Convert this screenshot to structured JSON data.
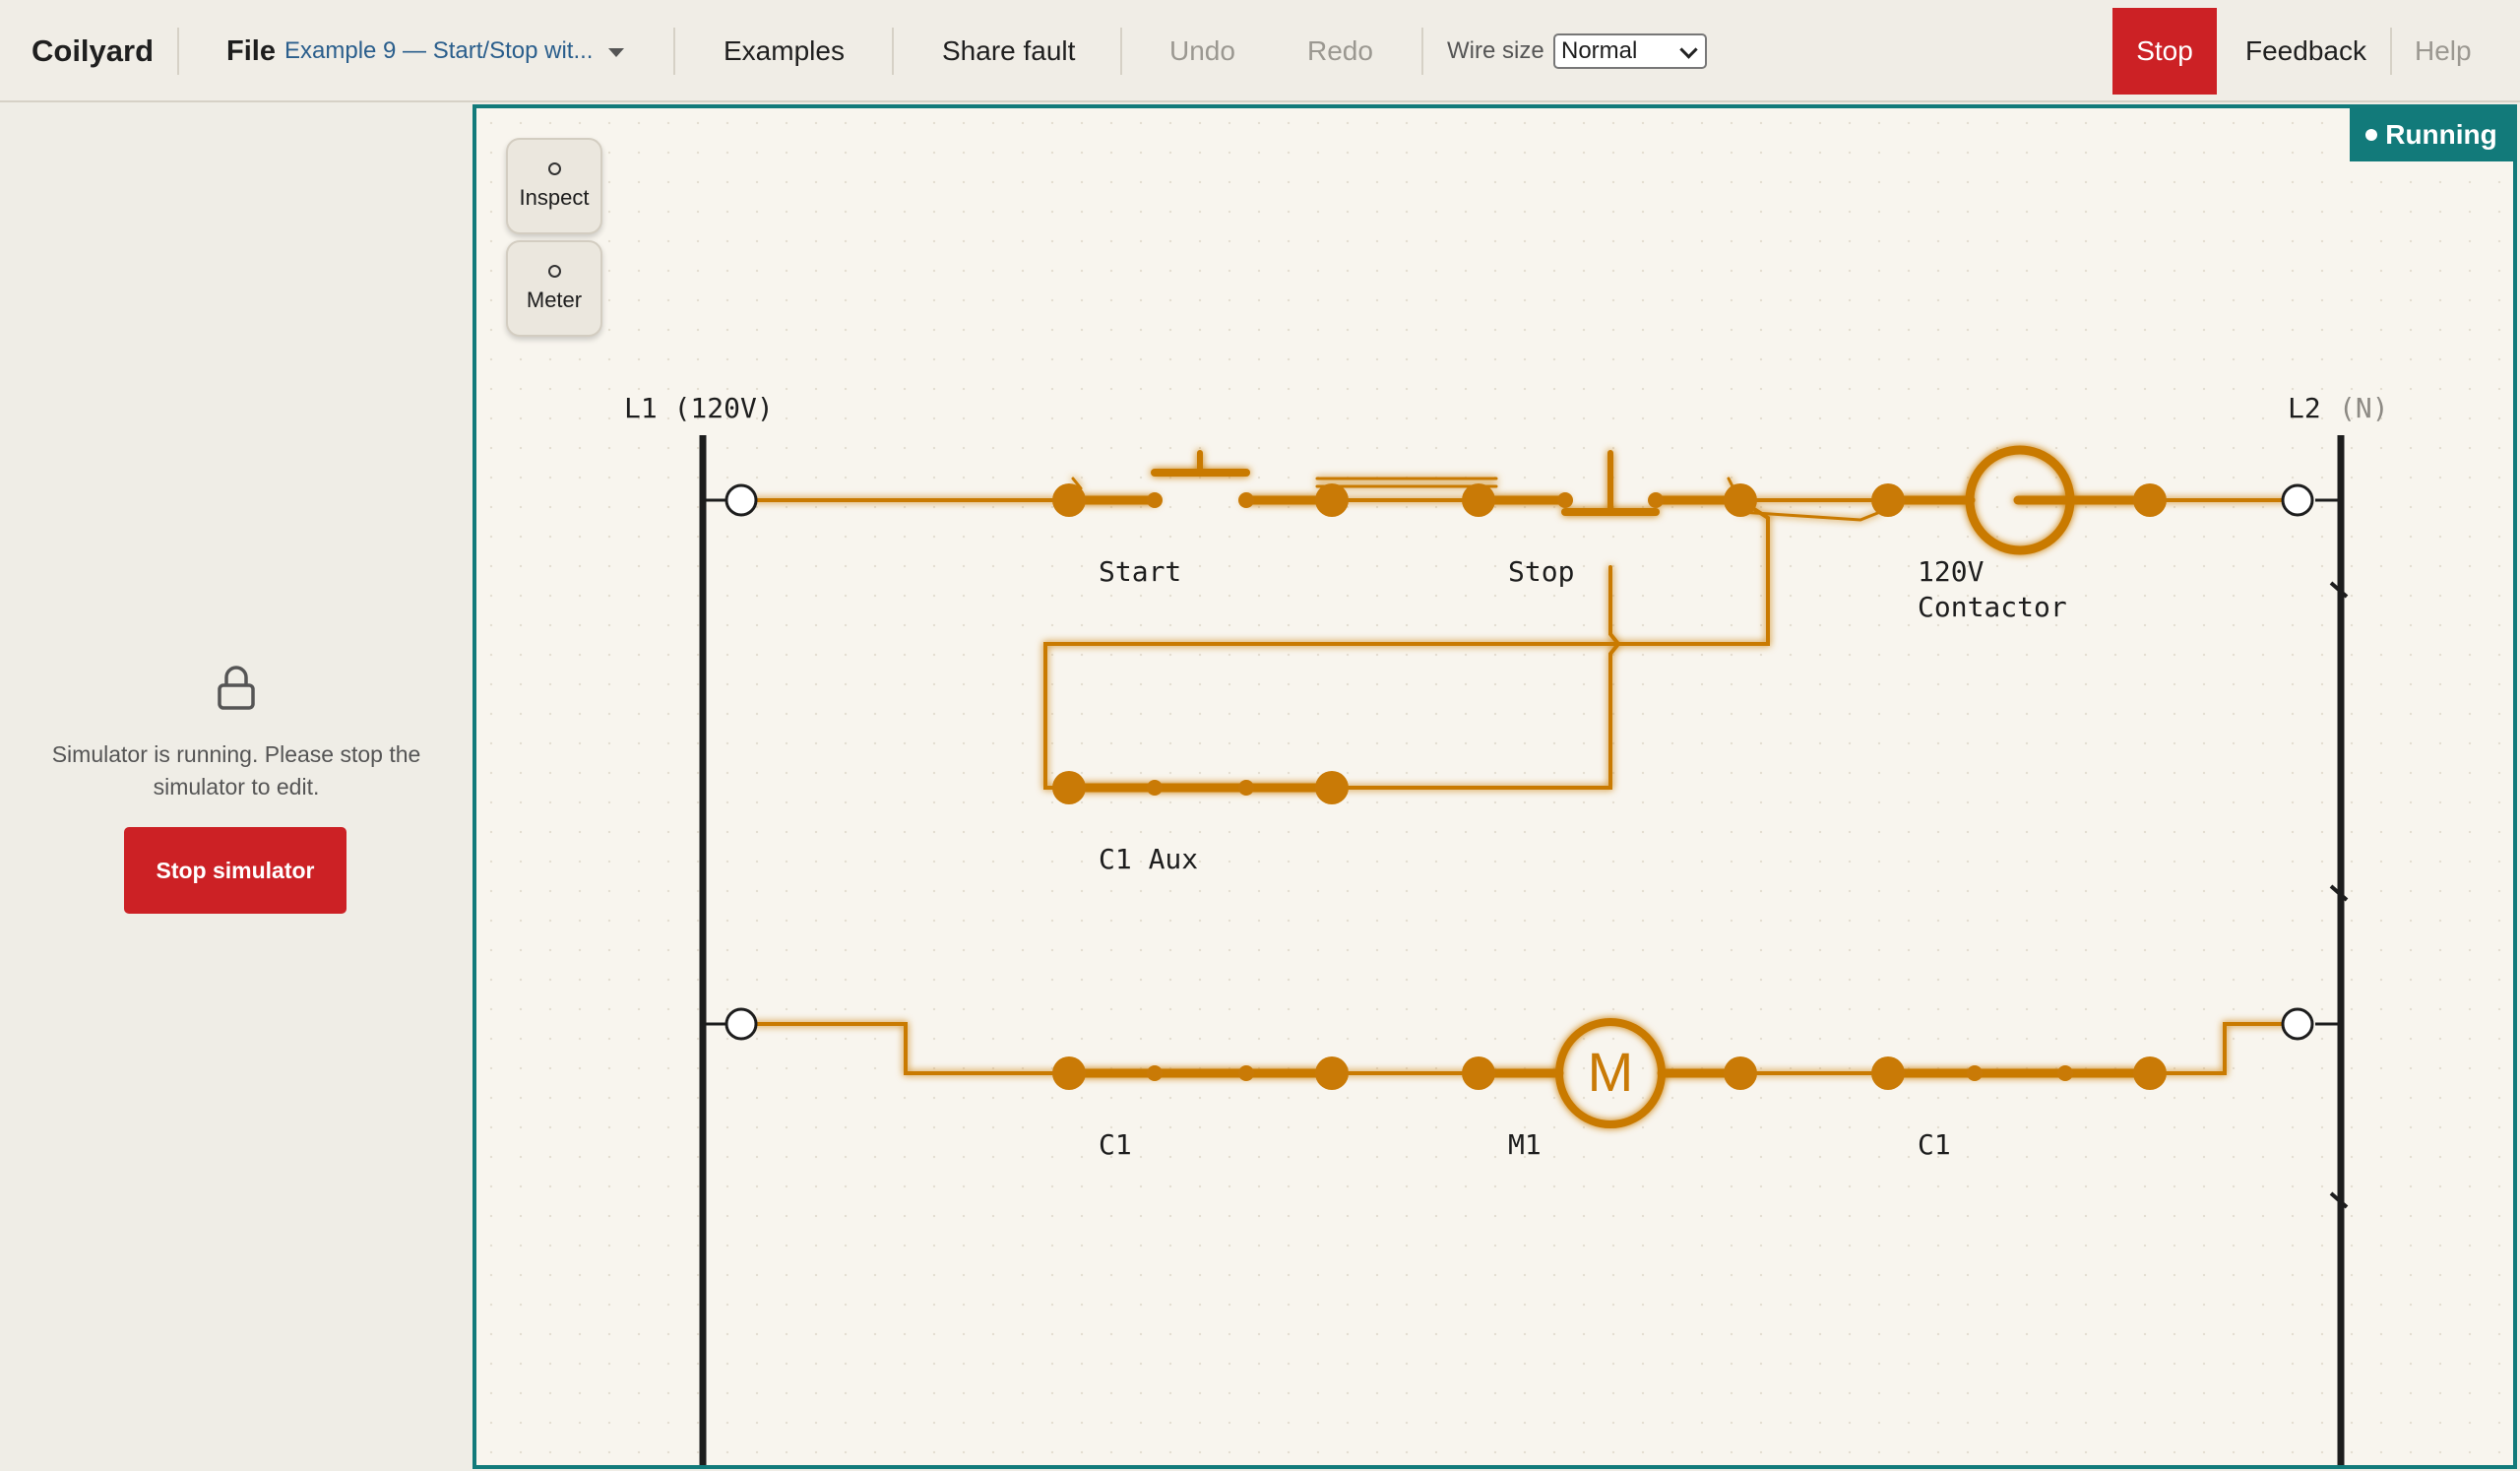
{
  "app": {
    "brand": "Coilyard"
  },
  "toolbar": {
    "file_label": "File",
    "file_name": "Example 9 — Start/Stop wit...",
    "examples": "Examples",
    "share_fault": "Share fault",
    "undo": "Undo",
    "redo": "Redo",
    "wire_size_label": "Wire size",
    "wire_size_value": "Normal",
    "stop": "Stop",
    "feedback": "Feedback",
    "help": "Help"
  },
  "sidebar": {
    "locked_message": "Simulator is running. Please stop the simulator to edit.",
    "stop_simulator": "Stop simulator"
  },
  "canvas": {
    "status": "Running",
    "tools": {
      "inspect": "Inspect",
      "meter": "Meter"
    },
    "rails": {
      "left": "L1 (120V)",
      "right_main": "L2",
      "right_sub": "(N)"
    },
    "labels": {
      "start": "Start",
      "stop": "Stop",
      "coil_line1": "120V",
      "coil_line2": "Contactor",
      "aux": "C1 Aux",
      "c1_left": "C1",
      "motor": "M1",
      "c1_right": "C1",
      "motor_symbol": "M"
    }
  },
  "colors": {
    "energized": "#c97a06",
    "accent": "#127a7a",
    "danger": "#cc2125",
    "link": "#2a5e8c"
  },
  "icons": [
    "lock-icon",
    "caret-down-icon",
    "chevron-down-icon",
    "status-dot-icon"
  ]
}
